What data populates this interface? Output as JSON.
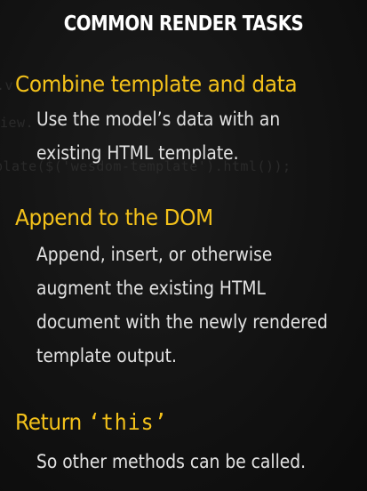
{
  "slide": {
    "title": "COMMON RENDER TASKS",
    "background_code": [
      ".v",
      "iew.",
      "plate($('wesdom-template').html());"
    ],
    "sections": [
      {
        "heading": "Combine template and data",
        "lines": [
          "Use the model’s data with an",
          "existing HTML template."
        ]
      },
      {
        "heading": "Append to the DOM",
        "lines": [
          "Append, insert, or otherwise",
          "augment the existing HTML",
          "document with the newly rendered",
          "template output."
        ]
      },
      {
        "heading_prefix": "Return ",
        "heading_code": "‘this’",
        "lines": [
          "So other methods can be called."
        ]
      }
    ]
  },
  "colors": {
    "accent": "#f3c11a",
    "text": "#e2e2e2",
    "title": "#ffffff",
    "background": "#121212"
  }
}
